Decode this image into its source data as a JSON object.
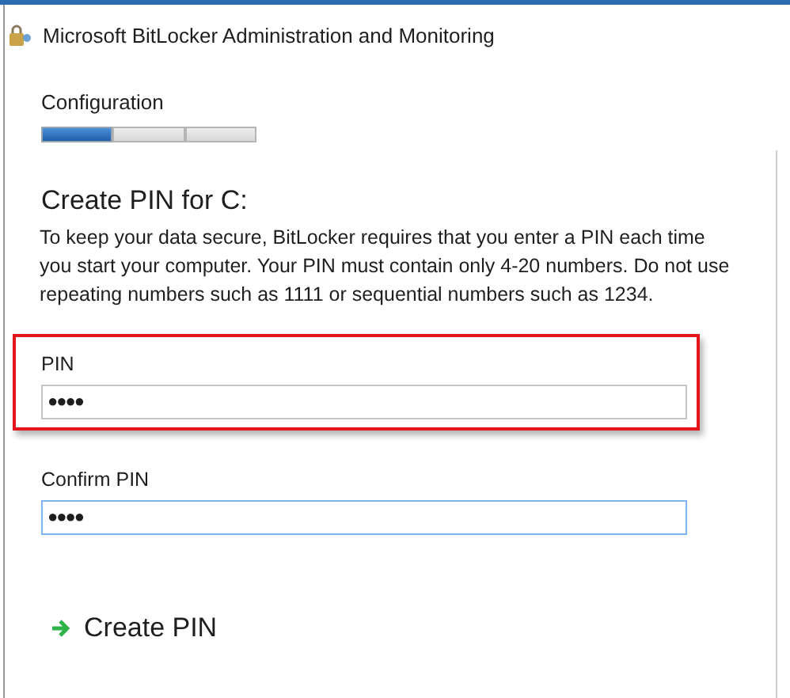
{
  "window": {
    "title": "Microsoft BitLocker Administration and Monitoring"
  },
  "progress": {
    "label": "Configuration",
    "steps": [
      {
        "done": true
      },
      {
        "done": false
      },
      {
        "done": false
      }
    ]
  },
  "heading": "Create PIN for C:",
  "description": "To keep your data secure, BitLocker requires that you enter a PIN each time you start your computer. Your PIN must contain only 4-20 numbers. Do not use repeating numbers such as 1111 or sequential numbers such as 1234.",
  "fields": [
    {
      "label": "PIN",
      "value": "●●●●",
      "highlighted": true,
      "focused": false
    },
    {
      "label": "Confirm PIN",
      "value": "●●●●",
      "highlighted": false,
      "focused": true
    }
  ],
  "action": {
    "label": "Create PIN"
  }
}
